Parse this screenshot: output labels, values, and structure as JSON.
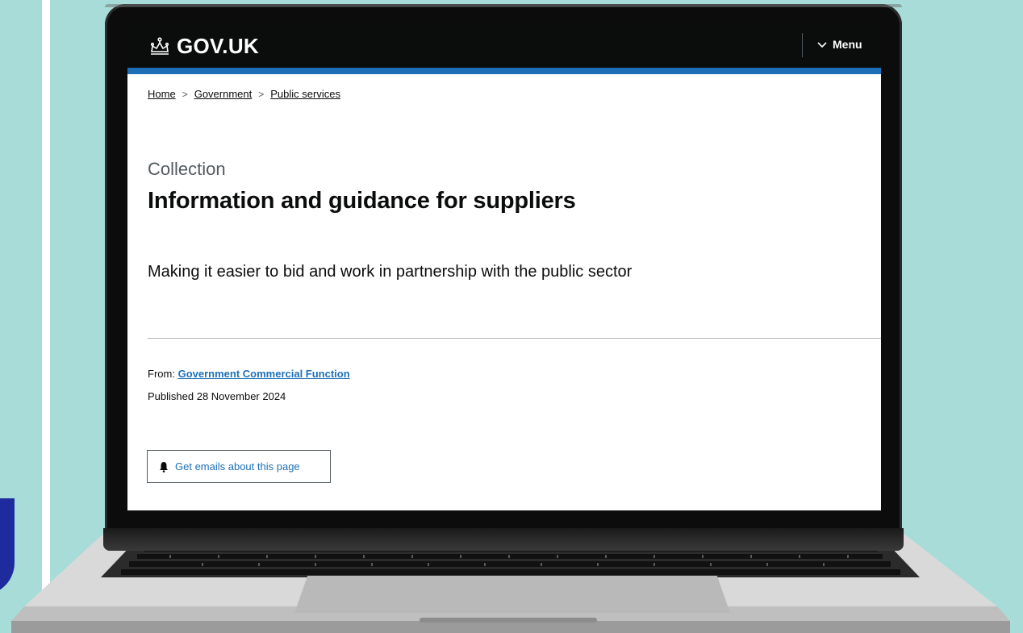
{
  "header": {
    "logo_text": "GOV.UK",
    "menu_label": "Menu"
  },
  "breadcrumb": {
    "items": [
      "Home",
      "Government",
      "Public services"
    ]
  },
  "main": {
    "caption": "Collection",
    "title": "Information and guidance for suppliers",
    "lead": "Making it easier to bid and work in partnership with the public sector",
    "meta": {
      "from_label": "From:",
      "from_link": "Government Commercial Function",
      "published": "Published 28 November 2024"
    },
    "email_button": "Get emails about this page"
  },
  "icons": {
    "logo": "crown-icon",
    "menu": "chevron-down-icon",
    "email": "bell-icon"
  },
  "colors": {
    "background": "#a8dcd8",
    "header": "#0b0c0c",
    "brand_blue": "#1d70b8",
    "accent_shape": "#1d2b9c"
  }
}
